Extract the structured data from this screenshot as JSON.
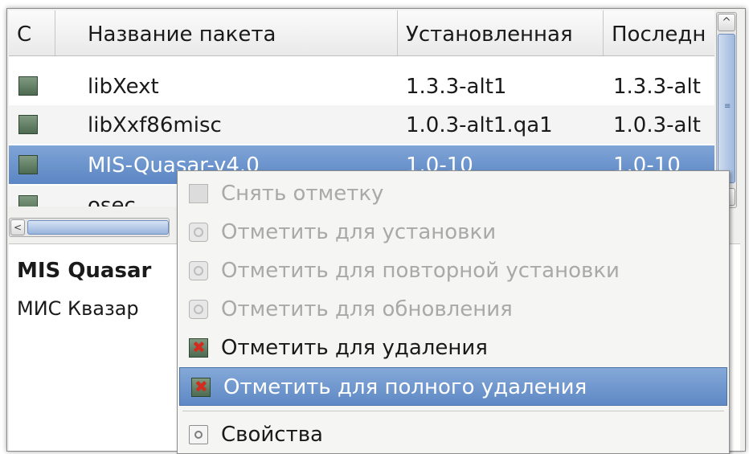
{
  "table": {
    "columns": [
      "С",
      "Название пакета",
      "Установленная",
      "Последн"
    ],
    "rows": [
      {
        "name": "libXext",
        "installed": "1.3.3-alt1",
        "latest": "1.3.3-alt"
      },
      {
        "name": "libXxf86misc",
        "installed": "1.0.3-alt1.qa1",
        "latest": "1.0.3-alt"
      },
      {
        "name": "MIS-Quasar-v4.0",
        "installed": "1.0-10",
        "latest": "1.0-10"
      },
      {
        "name": "osec",
        "installed": "",
        "latest": ""
      }
    ]
  },
  "scrollbars": {
    "up_arrow": "^",
    "down_arrow": "⌄",
    "left_arrow": "<",
    "thumb_grip": "≡"
  },
  "description": {
    "title": "MIS Quasar",
    "text": "МИС Квазар"
  },
  "context_menu": {
    "items": [
      {
        "label": "Снять отметку",
        "icon": "empty-checkbox-icon",
        "state": "disabled"
      },
      {
        "label": "Отметить для установки",
        "icon": "install-icon",
        "state": "disabled"
      },
      {
        "label": "Отметить для повторной установки",
        "icon": "reinstall-icon",
        "state": "disabled"
      },
      {
        "label": "Отметить для обновления",
        "icon": "upgrade-icon",
        "state": "disabled"
      },
      {
        "label": "Отметить для удаления",
        "icon": "remove-icon",
        "state": "enabled"
      },
      {
        "label": "Отметить для полного удаления",
        "icon": "purge-icon",
        "state": "highlighted"
      },
      {
        "label": "Свойства",
        "icon": "properties-icon",
        "state": "enabled"
      }
    ]
  },
  "colors": {
    "selection": "#5b86c4",
    "installed_marker": "#4d6b52",
    "remove_mark": "#d22b1f"
  }
}
